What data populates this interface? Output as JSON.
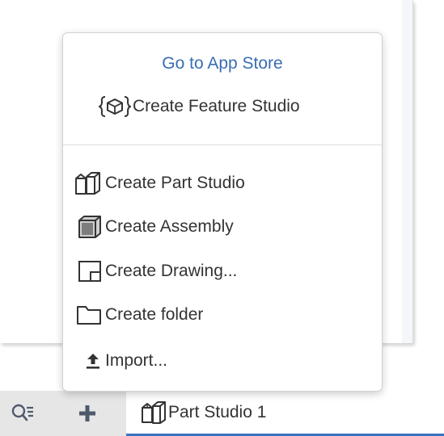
{
  "menu": {
    "app_store": "Go to App Store",
    "create_feature_studio": "Create Feature Studio",
    "create_part_studio": "Create Part Studio",
    "create_assembly": "Create Assembly",
    "create_drawing": "Create Drawing...",
    "create_folder": "Create folder",
    "import": "Import..."
  },
  "tabs": {
    "active_label": "Part Studio 1"
  },
  "icons": {
    "search": "search-filter-icon",
    "add": "plus-icon",
    "feature_studio": "feature-studio-icon",
    "part_studio": "part-studio-icon",
    "assembly": "assembly-icon",
    "drawing": "drawing-icon",
    "folder": "folder-icon",
    "import": "upload-icon"
  },
  "colors": {
    "link": "#3a6db4",
    "active_tab_underline": "#3b73c3",
    "tool_bar_bg": "#e6e6e6"
  }
}
